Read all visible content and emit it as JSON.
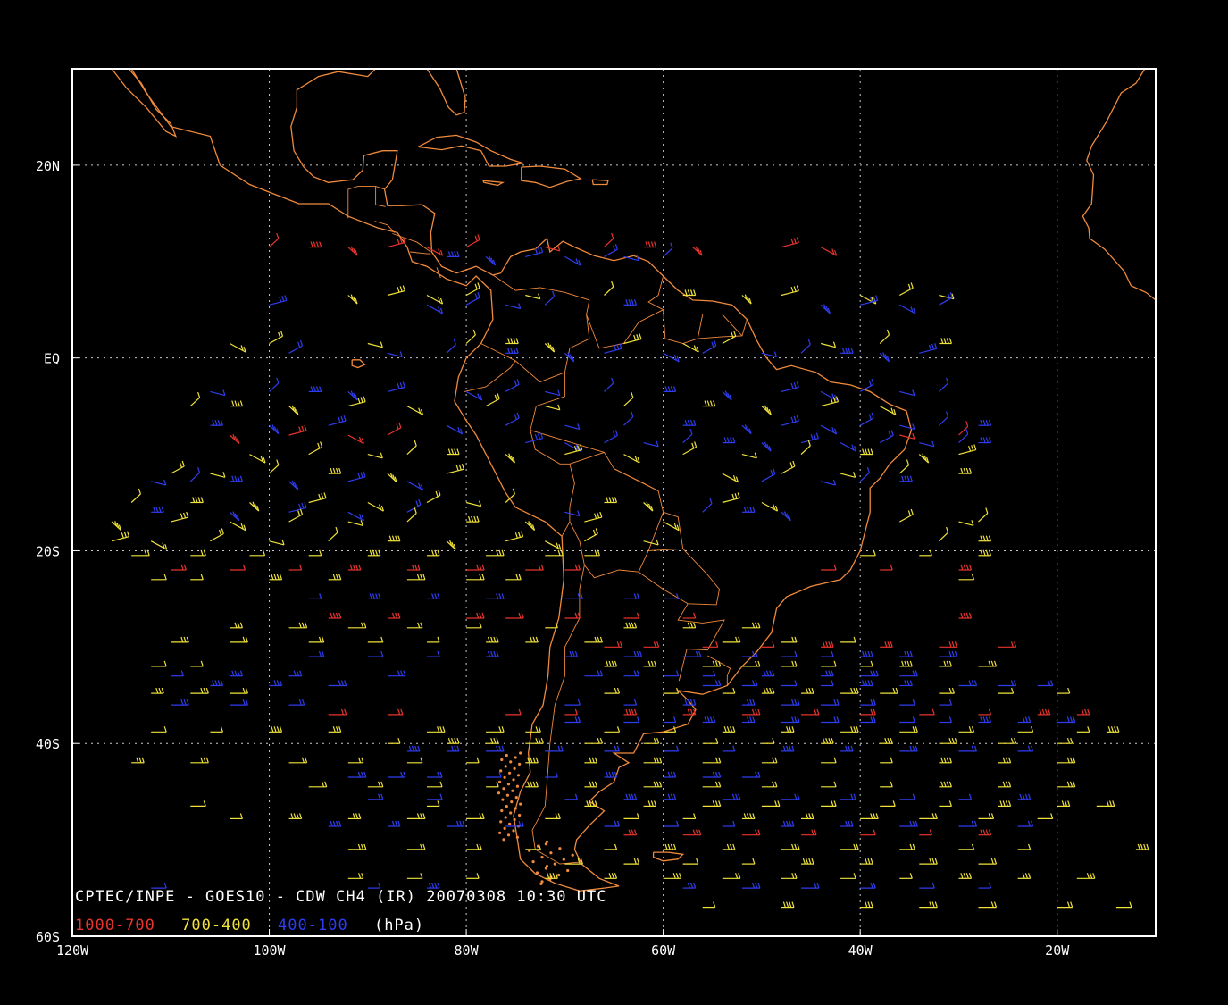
{
  "title": "CPTEC/INPE - GOES10 - CDW CH4 (IR) 20070308 10:30 UTC",
  "legend": {
    "low": {
      "label": "1000-700",
      "color": "#e8342e"
    },
    "mid": {
      "label": "700-400",
      "color": "#f0e23a"
    },
    "high": {
      "label": "400-100",
      "color": "#2f3df0"
    },
    "unit": "(hPa)"
  },
  "colors": {
    "coast": "#f08a3c",
    "grid": "#c8c8c8",
    "frame": "#ffffff",
    "background": "#000000"
  },
  "map": {
    "lon_range": [
      -120,
      -10
    ],
    "lat_range": [
      -60,
      30
    ],
    "x_ticks": [
      {
        "lon": -120,
        "label": "120W"
      },
      {
        "lon": -100,
        "label": "100W"
      },
      {
        "lon": -80,
        "label": "80W"
      },
      {
        "lon": -60,
        "label": "60W"
      },
      {
        "lon": -40,
        "label": "40W"
      },
      {
        "lon": -20,
        "label": "20W"
      }
    ],
    "y_ticks": [
      {
        "lat": 20,
        "label": "20N"
      },
      {
        "lat": 0,
        "label": "EQ"
      },
      {
        "lat": -20,
        "label": "20S"
      },
      {
        "lat": -40,
        "label": "40S"
      },
      {
        "lat": -60,
        "label": "60S"
      }
    ],
    "wind_rows": [
      {
        "lat": 11.5,
        "lon": [
          -100,
          -96,
          -92,
          -88,
          -84,
          -80,
          -72,
          -66,
          -62,
          -57,
          -48,
          -44
        ],
        "level": "low"
      },
      {
        "lat": 10.5,
        "lon": [
          -82,
          -78,
          -74,
          -70,
          -66,
          -64,
          -60
        ],
        "level": "high"
      },
      {
        "lat": 6.5,
        "lon": [
          -92,
          -88,
          -84,
          -80,
          -74,
          -66,
          -58,
          -52,
          -48,
          -40,
          -36,
          -32
        ],
        "level": "mid"
      },
      {
        "lat": 5.5,
        "lon": [
          -100,
          -84,
          -80,
          -76,
          -72,
          -64,
          -44,
          -40,
          -36,
          -32
        ],
        "level": "high"
      },
      {
        "lat": 1.5,
        "lon": [
          -104,
          -100,
          -90,
          -80,
          -76,
          -72,
          -64,
          -58,
          -54,
          -44,
          -38,
          -32
        ],
        "level": "mid"
      },
      {
        "lat": 0.5,
        "lon": [
          -98,
          -88,
          -82,
          -76,
          -70,
          -66,
          -60,
          -56,
          -50,
          -46,
          -42,
          -38,
          -34
        ],
        "level": "high"
      },
      {
        "lat": -3.5,
        "lon": [
          -106,
          -100,
          -96,
          -92,
          -88,
          -80,
          -76,
          -72,
          -66,
          -60,
          -54,
          -48,
          -44,
          -40,
          -36,
          -32
        ],
        "level": "high"
      },
      {
        "lat": -5.0,
        "lon": [
          -108,
          -104,
          -98,
          -92,
          -86,
          -78,
          -72,
          -64,
          -56,
          -50,
          -44,
          -38
        ],
        "level": "mid"
      },
      {
        "lat": -7.0,
        "lon": [
          -106,
          -100,
          -94,
          -82,
          -76,
          -70,
          -64,
          -58,
          -52,
          -48,
          -44,
          -40,
          -36,
          -32,
          -28
        ],
        "level": "high"
      },
      {
        "lat": -8.0,
        "lon": [
          -104,
          -98,
          -92,
          -88,
          -36,
          -30
        ],
        "level": "low"
      },
      {
        "lat": -8.8,
        "lon": [
          -74,
          -70,
          -66,
          -62,
          -58,
          -54,
          -50,
          -46,
          -42,
          -38,
          -34,
          -30,
          -28
        ],
        "level": "high"
      },
      {
        "lat": -10.0,
        "lon": [
          -102,
          -96,
          -90,
          -86,
          -82,
          -76,
          -70,
          -64,
          -58,
          -52,
          -46,
          -40,
          -34,
          -30
        ],
        "level": "mid"
      },
      {
        "lat": -12.0,
        "lon": [
          -110,
          -106,
          -100,
          -94,
          -88,
          -82,
          -54,
          -48,
          -42,
          -36,
          -30
        ],
        "level": "mid"
      },
      {
        "lat": -12.8,
        "lon": [
          -112,
          -108,
          -104,
          -98,
          -92,
          -86,
          -50,
          -44,
          -40,
          -36
        ],
        "level": "high"
      },
      {
        "lat": -15.0,
        "lon": [
          -114,
          -108,
          -102,
          -96,
          -90,
          -84,
          -80,
          -76,
          -66,
          -62,
          -54,
          -50
        ],
        "level": "mid"
      },
      {
        "lat": -16.0,
        "lon": [
          -112,
          -104,
          -98,
          -92,
          -86,
          -70,
          -56,
          -52,
          -48
        ],
        "level": "high"
      },
      {
        "lat": -17.0,
        "lon": [
          -116,
          -110,
          -104,
          -98,
          -92,
          -86,
          -80,
          -74,
          -68,
          -60,
          -36,
          -30,
          -28
        ],
        "level": "mid"
      },
      {
        "lat": -19.0,
        "lon": [
          -116,
          -112,
          -106,
          -100,
          -94,
          -88,
          -82,
          -76,
          -72,
          -68,
          -62,
          -32,
          -28
        ],
        "level": "mid"
      },
      {
        "lat": -20.5,
        "lon": [
          -114,
          -108,
          -102,
          -96,
          -90,
          -84,
          -78,
          -72,
          -68,
          -40,
          -34,
          -28
        ],
        "level": "mid"
      },
      {
        "lat": -22.0,
        "lon": [
          -110,
          -104,
          -98,
          -92,
          -86,
          -80,
          -74,
          -70,
          -44,
          -38,
          -30
        ],
        "level": "low"
      },
      {
        "lat": -23.0,
        "lon": [
          -112,
          -108,
          -100,
          -94,
          -86,
          -80,
          -76,
          -30
        ],
        "level": "mid"
      },
      {
        "lat": -25.0,
        "lon": [
          -96,
          -90,
          -84,
          -78,
          -70,
          -64,
          -60
        ],
        "level": "high"
      },
      {
        "lat": -27.0,
        "lon": [
          -94,
          -88,
          -80,
          -76,
          -70,
          -64,
          -58,
          -30
        ],
        "level": "low"
      },
      {
        "lat": -28.0,
        "lon": [
          -104,
          -98,
          -92,
          -86,
          -80,
          -72,
          -64,
          -58,
          -52
        ],
        "level": "mid"
      },
      {
        "lat": -29.5,
        "lon": [
          -110,
          -104,
          -96,
          -90,
          -84,
          -78,
          -74,
          -68,
          -54,
          -48,
          -42
        ],
        "level": "mid"
      },
      {
        "lat": -30.0,
        "lon": [
          -66,
          -62,
          -56,
          -50,
          -44,
          -38,
          -32,
          -26
        ],
        "level": "low"
      },
      {
        "lat": -31.0,
        "lon": [
          -96,
          -90,
          -84,
          -78,
          -70,
          -64,
          -58,
          -52,
          -48,
          -44,
          -40,
          -36,
          -32
        ],
        "level": "high"
      },
      {
        "lat": -32.0,
        "lon": [
          -112,
          -108,
          -66,
          -62,
          -56,
          -52,
          -48,
          -44,
          -40,
          -36,
          -32,
          -28
        ],
        "level": "mid"
      },
      {
        "lat": -33.0,
        "lon": [
          -110,
          -104,
          -98,
          -88,
          -68,
          -64,
          -60,
          -56,
          -50,
          -44,
          -40,
          -36
        ],
        "level": "high"
      },
      {
        "lat": -34.0,
        "lon": [
          -106,
          -100,
          -94,
          -56,
          -52,
          -48,
          -44,
          -40,
          -36,
          -30,
          -26,
          -22
        ],
        "level": "high"
      },
      {
        "lat": -34.8,
        "lon": [
          -112,
          -108,
          -104,
          -66,
          -60,
          -54,
          -50,
          -46,
          -42,
          -38,
          -32,
          -26,
          -20
        ],
        "level": "mid"
      },
      {
        "lat": -36.0,
        "lon": [
          -110,
          -104,
          -98,
          -70,
          -64,
          -58,
          -52,
          -48,
          -44,
          -40,
          -36,
          -32
        ],
        "level": "high"
      },
      {
        "lat": -37.0,
        "lon": [
          -94,
          -88,
          -76,
          -70,
          -64,
          -58,
          -52,
          -46,
          -40,
          -34,
          -28,
          -22,
          -18
        ],
        "level": "low"
      },
      {
        "lat": -37.8,
        "lon": [
          -70,
          -64,
          -60,
          -56,
          -52,
          -48,
          -44,
          -40,
          -36,
          -32,
          -28,
          -24,
          -20
        ],
        "level": "high"
      },
      {
        "lat": -38.8,
        "lon": [
          -112,
          -106,
          -100,
          -94,
          -84,
          -78,
          -74,
          -66,
          -60,
          -54,
          -48,
          -42,
          -36,
          -30,
          -24,
          -18,
          -15
        ],
        "level": "mid"
      },
      {
        "lat": -40.0,
        "lon": [
          -88,
          -82,
          -78,
          -74,
          -68,
          -62,
          -56,
          -50,
          -44,
          -38,
          -32,
          -26,
          -20
        ],
        "level": "mid"
      },
      {
        "lat": -40.8,
        "lon": [
          -86,
          -82,
          -78,
          -72,
          -66,
          -60,
          -54,
          -48,
          -42,
          -36,
          -30,
          -24
        ],
        "level": "high"
      },
      {
        "lat": -42.0,
        "lon": [
          -114,
          -108,
          -98,
          -92,
          -86,
          -80,
          -74,
          -68,
          -62,
          -56,
          -50,
          -44,
          -38,
          -32,
          -26,
          -20
        ],
        "level": "mid"
      },
      {
        "lat": -43.5,
        "lon": [
          -92,
          -88,
          -84,
          -78,
          -72,
          -66,
          -60,
          -56,
          -52
        ],
        "level": "high"
      },
      {
        "lat": -44.5,
        "lon": [
          -96,
          -90,
          -84,
          -78,
          -74,
          -68,
          -62,
          -56,
          -50,
          -44,
          -38,
          -32,
          -26,
          -20
        ],
        "level": "mid"
      },
      {
        "lat": -45.8,
        "lon": [
          -90,
          -84,
          -70,
          -64,
          -60,
          -54,
          -48,
          -42,
          -36,
          -30,
          -24
        ],
        "level": "high"
      },
      {
        "lat": -46.5,
        "lon": [
          -108,
          -84,
          -68,
          -62,
          -56,
          -50,
          -44,
          -38,
          -32,
          -26,
          -20,
          -16
        ],
        "level": "mid"
      },
      {
        "lat": -47.8,
        "lon": [
          -104,
          -98,
          -92,
          -86,
          -80,
          -72,
          -64,
          -58,
          -52,
          -46,
          -40,
          -34,
          -28,
          -22
        ],
        "level": "mid"
      },
      {
        "lat": -48.6,
        "lon": [
          -94,
          -88,
          -82,
          -76,
          -66,
          -60,
          -54,
          -48,
          -42,
          -36,
          -30,
          -24
        ],
        "level": "high"
      },
      {
        "lat": -49.5,
        "lon": [
          -64,
          -58,
          -52,
          -46,
          -40,
          -34,
          -28
        ],
        "level": "low"
      },
      {
        "lat": -51.0,
        "lon": [
          -92,
          -86,
          -80,
          -74,
          -66,
          -60,
          -54,
          -48,
          -42,
          -36,
          -30,
          -24,
          -12
        ],
        "level": "mid"
      },
      {
        "lat": -52.5,
        "lon": [
          -70,
          -64,
          -58,
          -52,
          -46,
          -40,
          -34,
          -28
        ],
        "level": "mid"
      },
      {
        "lat": -54.0,
        "lon": [
          -92,
          -86,
          -80,
          -72,
          -66,
          -60,
          -54,
          -48,
          -42,
          -36,
          -30,
          -24,
          -18
        ],
        "level": "mid"
      },
      {
        "lat": -55.0,
        "lon": [
          -112,
          -90,
          -84,
          -58,
          -52,
          -46,
          -40,
          -34,
          -28
        ],
        "level": "high"
      },
      {
        "lat": -57.0,
        "lon": [
          -56,
          -48,
          -40,
          -34,
          -28,
          -20,
          -14
        ],
        "level": "mid"
      }
    ]
  }
}
